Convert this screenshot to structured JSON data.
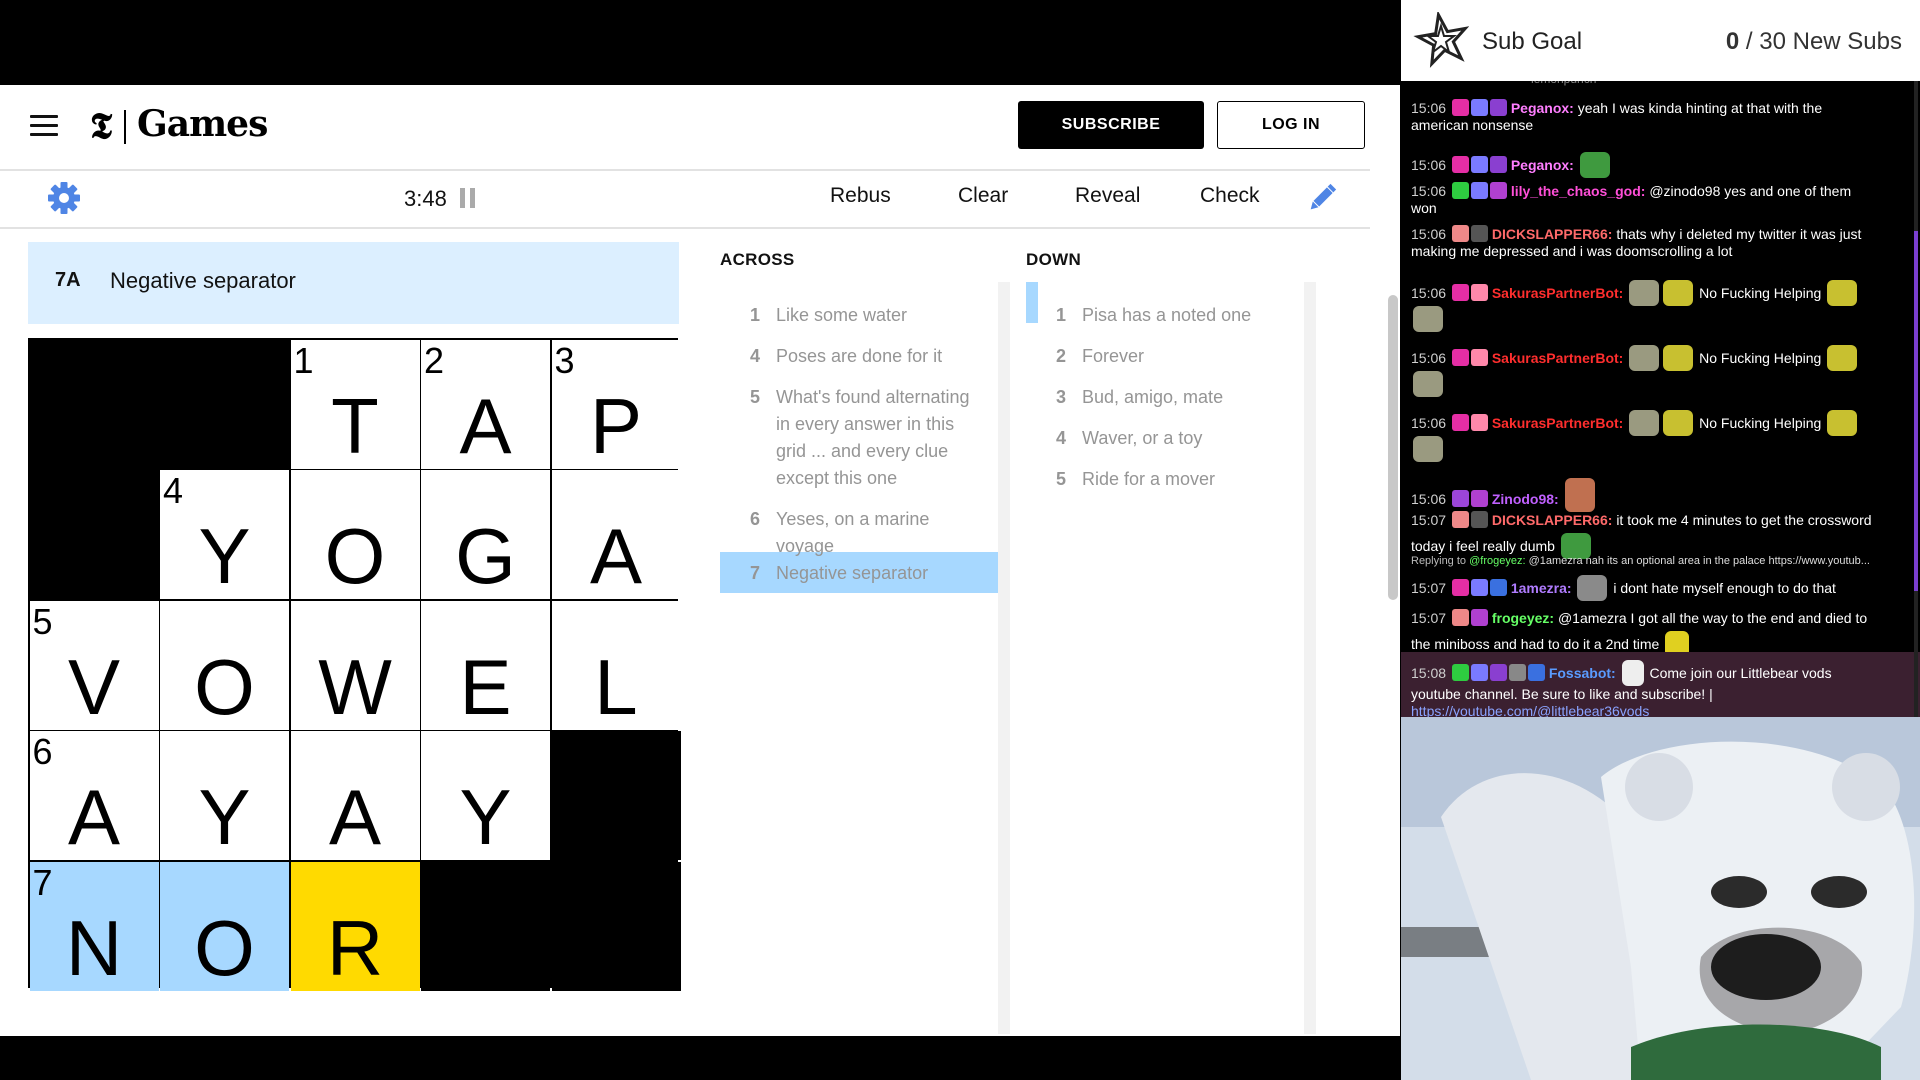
{
  "header": {
    "logo_mark": "𝕿",
    "logo_text": "Games",
    "subscribe_label": "SUBSCRIBE",
    "login_label": "LOG IN"
  },
  "toolbar": {
    "timer": "3:48",
    "rebus": "Rebus",
    "clear": "Clear",
    "reveal": "Reveal",
    "check": "Check"
  },
  "active_clue": {
    "number": "7A",
    "text": "Negative separator"
  },
  "grid": {
    "rows": [
      [
        {
          "black": true
        },
        {
          "black": true
        },
        {
          "num": "1",
          "letter": "T"
        },
        {
          "num": "2",
          "letter": "A"
        },
        {
          "num": "3",
          "letter": "P"
        }
      ],
      [
        {
          "black": true
        },
        {
          "num": "4",
          "letter": "Y"
        },
        {
          "letter": "O"
        },
        {
          "letter": "G"
        },
        {
          "letter": "A"
        }
      ],
      [
        {
          "num": "5",
          "letter": "V"
        },
        {
          "letter": "O"
        },
        {
          "letter": "W"
        },
        {
          "letter": "E"
        },
        {
          "letter": "L"
        }
      ],
      [
        {
          "num": "6",
          "letter": "A"
        },
        {
          "letter": "Y"
        },
        {
          "letter": "A"
        },
        {
          "letter": "Y"
        },
        {
          "black": true
        }
      ],
      [
        {
          "num": "7",
          "letter": "N",
          "state": "hl"
        },
        {
          "letter": "O",
          "state": "hl"
        },
        {
          "letter": "R",
          "state": "sel"
        },
        {
          "black": true
        },
        {
          "black": true
        }
      ]
    ]
  },
  "across": {
    "title": "ACROSS",
    "clues": [
      {
        "n": "1",
        "text": "Like some water"
      },
      {
        "n": "4",
        "text": "Poses are done for it"
      },
      {
        "n": "5",
        "text": "What's found alternating in every answer in this grid ... and every clue except this one"
      },
      {
        "n": "6",
        "text": "Yeses, on a marine voyage"
      },
      {
        "n": "7",
        "text": "Negative separator"
      }
    ]
  },
  "down": {
    "title": "DOWN",
    "clues": [
      {
        "n": "1",
        "text": "Pisa has a noted one"
      },
      {
        "n": "2",
        "text": "Forever"
      },
      {
        "n": "3",
        "text": "Bud, amigo, mate"
      },
      {
        "n": "4",
        "text": "Waver, or a toy"
      },
      {
        "n": "5",
        "text": "Ride for a mover"
      }
    ]
  },
  "sub_goal": {
    "label": "Sub Goal",
    "current": "0",
    "target": "/ 30 New Subs"
  },
  "chat": {
    "messages": [
      {
        "ts": "15:06",
        "name": "Peganox:",
        "color": "#ff7eff",
        "text": "yeah I was kinda hinting at that with the",
        "text2": "american nonsense"
      },
      {
        "ts": "15:06",
        "name": "Peganox:",
        "color": "#ff7eff",
        "text": ""
      },
      {
        "ts": "15:06",
        "name": "lily_the_chaos_god:",
        "color": "#ff4fd8",
        "text": "@zinodo98 yes and one of them",
        "text2": "won"
      },
      {
        "ts": "15:06",
        "name": "DICKSLAPPER66:",
        "color": "#ff6a6a",
        "text": "thats why i deleted my twitter it was just",
        "text2": "making me depressed and i was doomscrolling a lot"
      },
      {
        "ts": "15:06",
        "name": "SakurasPartnerBot:",
        "color": "#ff2e2e",
        "text": "No Fucking Helping"
      },
      {
        "ts": "15:06",
        "name": "SakurasPartnerBot:",
        "color": "#ff2e2e",
        "text": "No Fucking Helping"
      },
      {
        "ts": "15:06",
        "name": "SakurasPartnerBot:",
        "color": "#ff2e2e",
        "text": "No Fucking Helping"
      },
      {
        "ts": "15:06",
        "name": "Zinodo98:",
        "color": "#c060ff",
        "text": ""
      },
      {
        "ts": "15:07",
        "name": "DICKSLAPPER66:",
        "color": "#ff6a6a",
        "text": "it took me 4 minutes to get the crossword",
        "text2": "today i feel really dumb"
      },
      {
        "ts": "15:07",
        "name": "1amezra:",
        "color": "#b07cff",
        "text": "i dont hate myself enough to do that"
      },
      {
        "ts": "15:07",
        "name": "frogeyez:",
        "color": "#66ff66",
        "text": "@1amezra I got all the way to the end and died to",
        "text2": "the miniboss and had to do it a 2nd time"
      },
      {
        "ts": "15:08",
        "name": "Fossabot:",
        "color": "#5a9bff",
        "text": "Come join our Littlebear vods",
        "text2": "youtube channel. Be sure to like and subscribe! |",
        "link": "https://youtube.com/@littlebear36vods"
      }
    ],
    "reply_prefix": "Replying to",
    "reply_name": "@frogeyez:",
    "reply_text": "@1amezra nah its an optional area in the palace https://www.youtub...",
    "partial_top": "lemonpunch"
  },
  "colors": {
    "highlight": "#a7d8ff",
    "selected": "#ffda00",
    "accent": "#4f85e5"
  }
}
